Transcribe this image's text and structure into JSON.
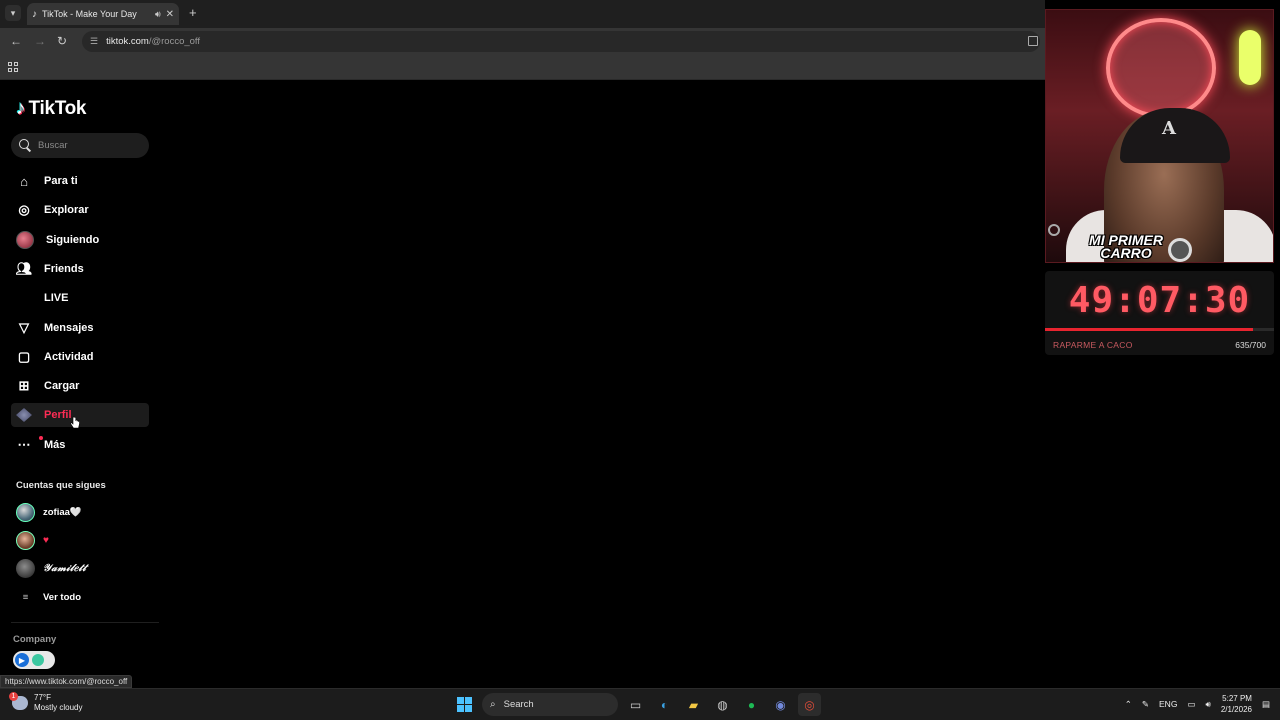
{
  "browser": {
    "tab_title": "TikTok - Make Your Day",
    "url_host": "tiktok.com",
    "url_path": "/@rocco_off",
    "status_url": "https://www.tiktok.com/@rocco_off"
  },
  "brand": {
    "name": "TikTok"
  },
  "search": {
    "placeholder": "Buscar"
  },
  "nav": {
    "para_ti": "Para ti",
    "explorar": "Explorar",
    "siguiendo": "Siguiendo",
    "friends": "Friends",
    "live": "LIVE",
    "mensajes": "Mensajes",
    "actividad": "Actividad",
    "cargar": "Cargar",
    "perfil": "Perfil",
    "mas": "Más"
  },
  "following": {
    "title": "Cuentas que sigues",
    "accounts": [
      "zofiaa🤍",
      "",
      "𝒴𝒶𝓂𝒾𝓁𝑒𝓉𝓉"
    ],
    "see_all": "Ver todo"
  },
  "footer": {
    "company": "Company"
  },
  "stream_overlay": {
    "webcam_caption": "MI PRIMER CARRO",
    "timer": "49:07:30",
    "goal_label": "RAPARME A CACO",
    "goal_count": "635/700",
    "goal_progress": 0.907
  },
  "taskbar": {
    "weather_temp": "77°F",
    "weather_desc": "Mostly cloudy",
    "weather_badge": "1",
    "search_label": "Search",
    "lang": "ENG",
    "time": "5:27 PM",
    "date": "2/1/2026"
  },
  "colors": {
    "tiktok_red": "#fe2c55",
    "timer_red": "#ff5a63"
  }
}
